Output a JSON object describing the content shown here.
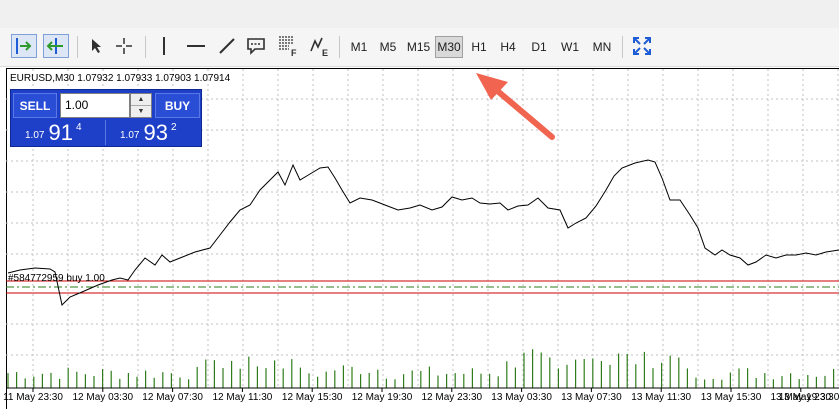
{
  "toolbar": {
    "timeframes": [
      {
        "label": "M1",
        "active": false
      },
      {
        "label": "M5",
        "active": false
      },
      {
        "label": "M15",
        "active": false
      },
      {
        "label": "M30",
        "active": true
      },
      {
        "label": "H1",
        "active": false
      },
      {
        "label": "H4",
        "active": false
      },
      {
        "label": "D1",
        "active": false
      },
      {
        "label": "W1",
        "active": false
      },
      {
        "label": "MN",
        "active": false
      }
    ],
    "tools": [
      "autoscroll-icon",
      "chart-shift-icon",
      "cursor-icon",
      "crosshair-icon",
      "vertical-line-icon",
      "horizontal-line-icon",
      "trendline-icon",
      "text-label-icon",
      "fibonacci-icon",
      "elliott-wave-icon",
      "fullscreen-icon"
    ]
  },
  "chart": {
    "symbol_line": "EURUSD,M30  1.07932 1.07933 1.07903 1.07914",
    "order_line_label": "#584772959 buy 1.00",
    "time_labels": [
      "11 May 23:30",
      "12 May 03:30",
      "12 May 07:30",
      "12 May 11:30",
      "12 May 15:30",
      "12 May 19:30",
      "12 May 23:30",
      "13 May 03:30",
      "13 May 07:30",
      "13 May 11:30",
      "13 May 15:30",
      "13 May 19:30",
      "13 May 23:30"
    ],
    "colors": {
      "price_line": "#000000",
      "grid": "#c0c0c0",
      "volume": "#2e7d1a",
      "order_line": "#2e7d1a",
      "sl_tp_line": "#cc0000"
    }
  },
  "one_click": {
    "sell_label": "SELL",
    "buy_label": "BUY",
    "lot_value": "1.00",
    "sell_price_prefix": "1.07",
    "sell_price_big": "91",
    "sell_price_sup": "4",
    "buy_price_prefix": "1.07",
    "buy_price_big": "93",
    "buy_price_sup": "2"
  },
  "annotation": {
    "arrow_color": "#f06450"
  }
}
